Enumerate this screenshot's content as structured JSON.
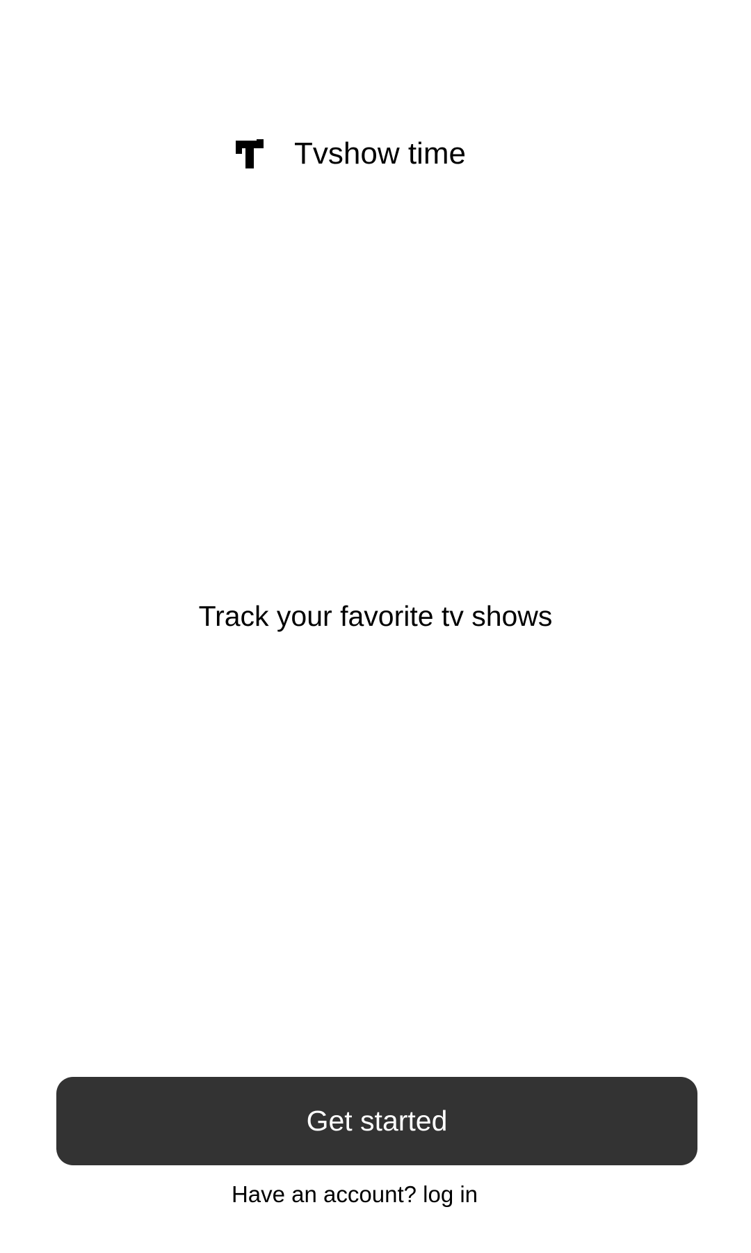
{
  "app": {
    "name": "Tvshow time",
    "logo_icon": "tv-t-logo-icon"
  },
  "onboarding": {
    "tagline": "Track your favorite tv shows",
    "get_started_label": "Get started",
    "login_link_label": "Have an account? log in"
  },
  "colors": {
    "background": "#ffffff",
    "button_background": "#333333",
    "button_text": "#ffffff",
    "text": "#000000"
  }
}
